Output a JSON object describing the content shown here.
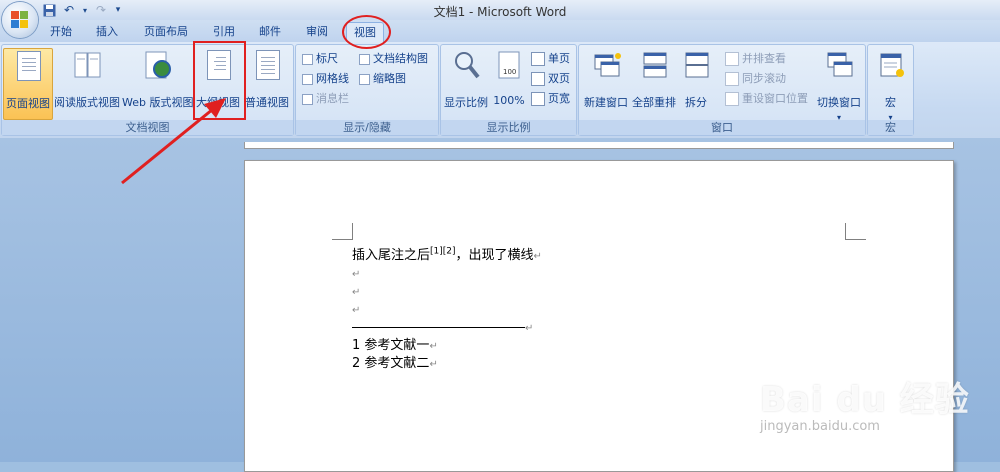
{
  "window": {
    "title": "文档1 - Microsoft Word"
  },
  "qat": {
    "save": "save-icon",
    "undo": "undo-icon",
    "redo": "redo-icon",
    "more": "▾"
  },
  "tabs": [
    "开始",
    "插入",
    "页面布局",
    "引用",
    "邮件",
    "审阅",
    "视图"
  ],
  "active_tab": "视图",
  "groups": {
    "doc_views": {
      "label": "文档视图",
      "buttons": [
        "页面视图",
        "阅读版式视图",
        "Web 版式视图",
        "大纲视图",
        "普通视图"
      ]
    },
    "show_hide": {
      "label": "显示/隐藏",
      "items": [
        "标尺",
        "网格线",
        "消息栏",
        "文档结构图",
        "缩略图"
      ]
    },
    "zoom": {
      "label": "显示比例",
      "buttons": [
        "显示比例",
        "100%"
      ],
      "small": [
        "单页",
        "双页",
        "页宽"
      ]
    },
    "window": {
      "label": "窗口",
      "buttons": [
        "新建窗口",
        "全部重排",
        "拆分"
      ],
      "small": [
        "并排查看",
        "同步滚动",
        "重设窗口位置"
      ],
      "switch": "切换窗口"
    },
    "macro": {
      "label": "宏",
      "button": "宏"
    }
  },
  "document": {
    "line1_text": "插入尾注之后",
    "line1_sup": "[1][2]",
    "line1_rest": "，出现了横线",
    "para_mark": "↵",
    "refs": [
      {
        "num": "1",
        "text": "参考文献一"
      },
      {
        "num": "2",
        "text": "参考文献二"
      }
    ]
  },
  "watermark": {
    "brand": "Bai du 经验",
    "url": "jingyan.baidu.com"
  },
  "colors": {
    "accent": "#e02020",
    "ribbon": "#dde9f8",
    "selected": "#fbc254"
  }
}
